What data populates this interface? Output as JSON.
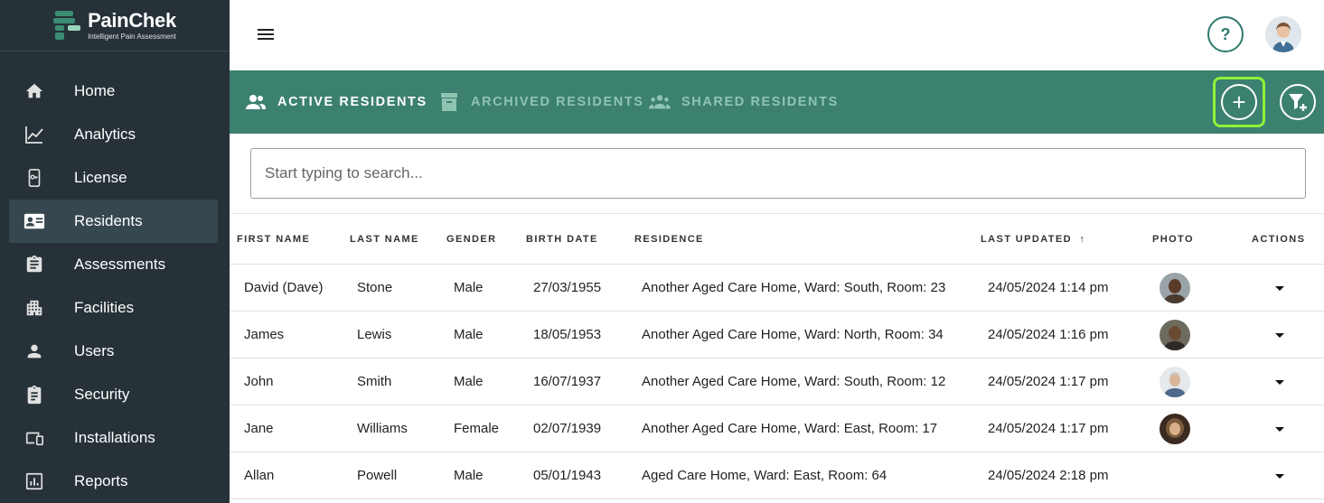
{
  "app": {
    "brand": "PainChek",
    "tagline": "Intelligent Pain Assessment"
  },
  "sidebar": {
    "items": [
      {
        "label": "Home",
        "icon": "home-icon"
      },
      {
        "label": "Analytics",
        "icon": "line-chart-icon"
      },
      {
        "label": "License",
        "icon": "license-phone-icon"
      },
      {
        "label": "Residents",
        "icon": "id-card-icon",
        "active": true
      },
      {
        "label": "Assessments",
        "icon": "clipboard-icon"
      },
      {
        "label": "Facilities",
        "icon": "building-icon"
      },
      {
        "label": "Users",
        "icon": "person-icon"
      },
      {
        "label": "Security",
        "icon": "clipboard-badge-icon"
      },
      {
        "label": "Installations",
        "icon": "devices-icon"
      },
      {
        "label": "Reports",
        "icon": "bar-report-icon"
      }
    ]
  },
  "header": {
    "help_label": "?"
  },
  "tabs": [
    {
      "label": "ACTIVE RESIDENTS",
      "icon": "people-icon",
      "active": true
    },
    {
      "label": "ARCHIVED RESIDENTS",
      "icon": "archive-icon",
      "active": false
    },
    {
      "label": "SHARED RESIDENTS",
      "icon": "group-icon",
      "active": false
    }
  ],
  "toolbar": {
    "add_label": "+"
  },
  "search": {
    "placeholder": "Start typing to search..."
  },
  "table": {
    "columns": [
      "FIRST NAME",
      "LAST NAME",
      "GENDER",
      "BIRTH DATE",
      "RESIDENCE",
      "LAST UPDATED",
      "PHOTO",
      "ACTIONS"
    ],
    "sort_indicator": "↑",
    "rows": [
      {
        "first": "David (Dave)",
        "last": "Stone",
        "gender": "Male",
        "birth": "27/03/1955",
        "residence": "Another Aged Care Home, Ward: South, Room: 23",
        "updated": "24/05/2024 1:14 pm",
        "has_photo": true
      },
      {
        "first": "James",
        "last": "Lewis",
        "gender": "Male",
        "birth": "18/05/1953",
        "residence": "Another Aged Care Home, Ward: North, Room: 34",
        "updated": "24/05/2024 1:16 pm",
        "has_photo": true
      },
      {
        "first": "John",
        "last": "Smith",
        "gender": "Male",
        "birth": "16/07/1937",
        "residence": "Another Aged Care Home, Ward: South, Room: 12",
        "updated": "24/05/2024 1:17 pm",
        "has_photo": true
      },
      {
        "first": "Jane",
        "last": "Williams",
        "gender": "Female",
        "birth": "02/07/1939",
        "residence": "Another Aged Care Home, Ward: East, Room: 17",
        "updated": "24/05/2024 1:17 pm",
        "has_photo": true
      },
      {
        "first": "Allan",
        "last": "Powell",
        "gender": "Male",
        "birth": "05/01/1943",
        "residence": "Aged Care Home, Ward: East, Room: 64",
        "updated": "24/05/2024 2:18 pm",
        "has_photo": false
      }
    ]
  },
  "colors": {
    "sidebar_bg": "#263238",
    "tabbar_bg": "#3c8070",
    "add_highlight": "#8ef23a",
    "accent": "#2f7a6d"
  }
}
